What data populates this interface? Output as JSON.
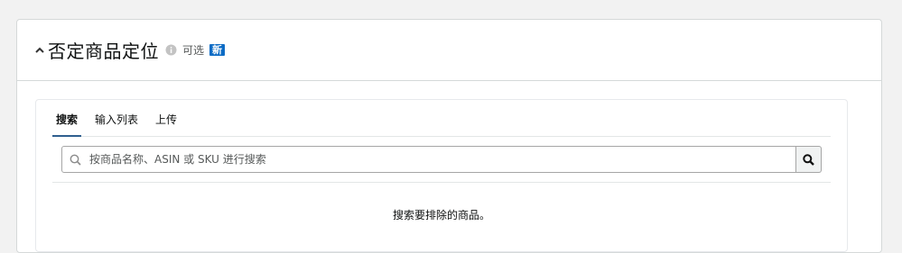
{
  "section": {
    "title": "否定商品定位",
    "optional_label": "可选",
    "new_badge": "新"
  },
  "tabs": [
    {
      "label": "搜索",
      "active": true
    },
    {
      "label": "输入列表",
      "active": false
    },
    {
      "label": "上传",
      "active": false
    }
  ],
  "search": {
    "placeholder": "按商品名称、ASIN 或 SKU 进行搜索",
    "value": ""
  },
  "empty_state": {
    "message": "搜索要排除的商品。"
  },
  "colors": {
    "badge": "#0d6cc5",
    "active_tab_underline": "#2f5f8f",
    "border": "#d5d9d9"
  },
  "icons": [
    "chevron-up-icon",
    "info-icon",
    "search-icon"
  ]
}
